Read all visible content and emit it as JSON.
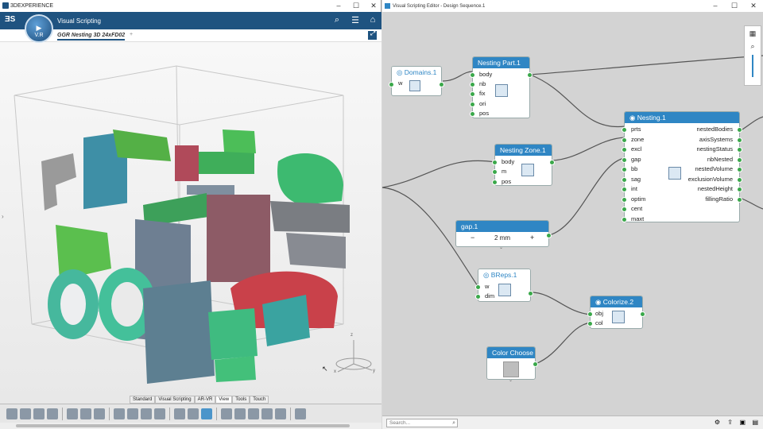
{
  "left_window": {
    "title": "3DEXPERIENCE",
    "app_name": "Visual Scripting",
    "compass_version": "V.R",
    "tab_label": "GGR Nesting 3D 24xFD02",
    "tab_add": "+",
    "command_tabs": [
      "Standard",
      "Visual Scripting",
      "AR-VR",
      "View",
      "Tools",
      "Touch"
    ],
    "active_command_tab": "View",
    "axis_labels": {
      "x": "x",
      "y": "y",
      "z": "z"
    }
  },
  "right_window": {
    "title": "Visual Scripting Editor - Design Sequence.1",
    "search_placeholder": "Search..."
  },
  "nodes": {
    "domains": {
      "title": "Domains.1",
      "inputs": [
        "w"
      ]
    },
    "nesting_part": {
      "title": "Nesting Part.1",
      "inputs": [
        "body",
        "nb",
        "fix",
        "ori",
        "pos"
      ]
    },
    "nesting_zone": {
      "title": "Nesting Zone.1",
      "inputs": [
        "body",
        "m",
        "pos"
      ]
    },
    "gap": {
      "title": "gap.1",
      "value": "2 mm",
      "minus": "−",
      "plus": "+"
    },
    "breps": {
      "title": "BReps.1",
      "inputs": [
        "w",
        "dim"
      ]
    },
    "colorize": {
      "title": "Colorize.2",
      "inputs": [
        "obj",
        "col"
      ]
    },
    "color_chooser": {
      "title": "Color Choose"
    },
    "nesting": {
      "title": "Nesting.1",
      "inputs": [
        "prts",
        "zone",
        "excl",
        "gap",
        "bb",
        "sag",
        "int",
        "optim",
        "cent",
        "maxt"
      ],
      "outputs": [
        "nestedBodies",
        "axisSystems",
        "nestingStatus",
        "nbNested",
        "nestedVolume",
        "exclusionVolume",
        "nestedHeight",
        "fillingRatio"
      ]
    }
  },
  "colors": {
    "accent": "#2f86c4",
    "port": "#3aa84a",
    "appbar": "#1f5380"
  }
}
